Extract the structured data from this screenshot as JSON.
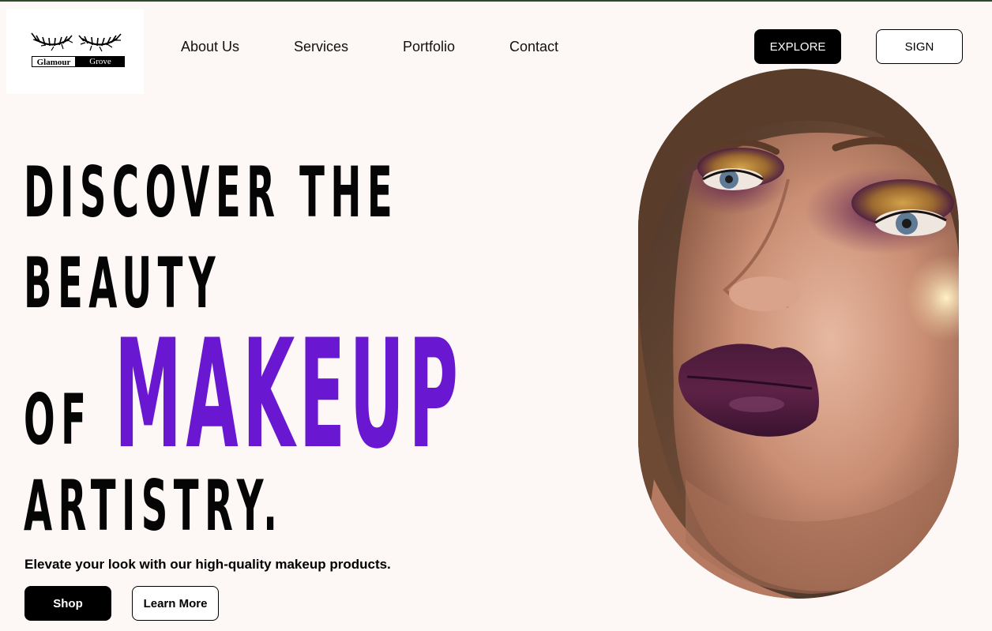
{
  "brand": {
    "logo_word_1": "Glamour",
    "logo_word_2": "Grove"
  },
  "nav": {
    "items": [
      {
        "label": "About Us"
      },
      {
        "label": "Services"
      },
      {
        "label": "Portfolio"
      },
      {
        "label": "Contact"
      }
    ]
  },
  "header_buttons": {
    "explore_label": "EXPLORE",
    "sign_label": "SIGN"
  },
  "hero": {
    "line_1": "DISCOVER THE",
    "line_2": "BEAUTY",
    "line_3_prefix": "OF",
    "line_3_highlight": "MAKEUP",
    "line_4": "ARTISTRY.",
    "subtext": "Elevate your look with our high-quality makeup products.",
    "shop_label": "Shop",
    "learn_more_label": "Learn More"
  },
  "colors": {
    "page_background": "#FDF7F6",
    "accent_purple": "#6A17D2",
    "button_dark": "#000000",
    "top_border": "#2E4A2C"
  },
  "icons": {
    "logo": "eyelashes-logo-icon",
    "portrait": "makeup-model-portrait"
  }
}
